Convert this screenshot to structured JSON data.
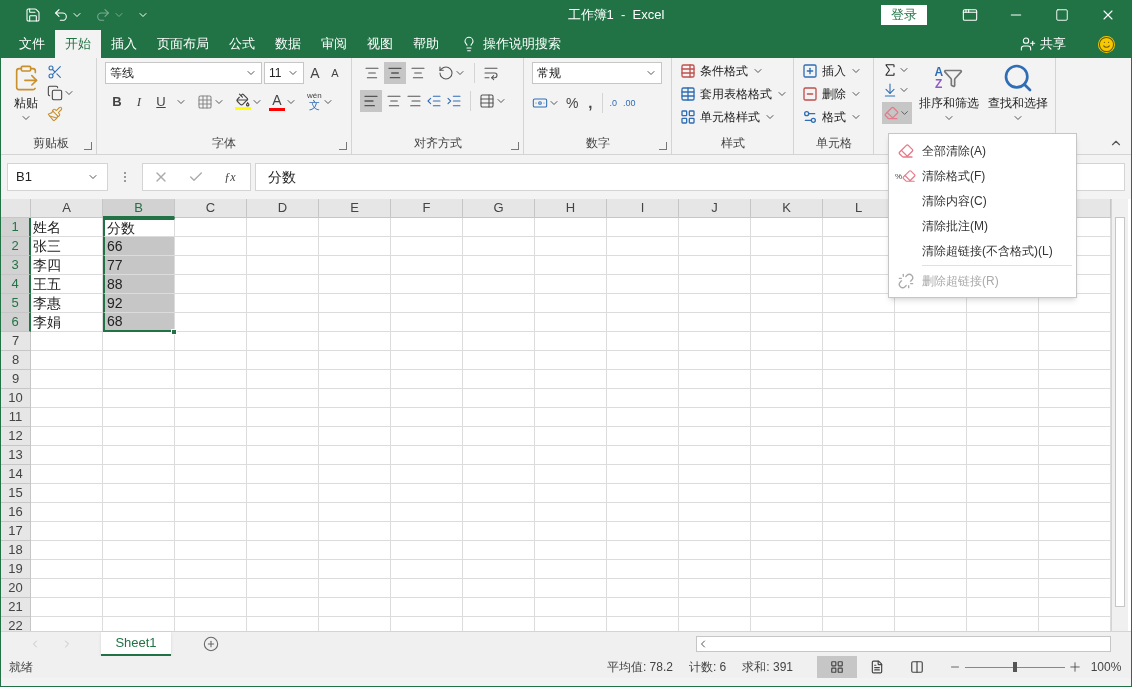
{
  "window": {
    "title": "工作簿1  -  Excel",
    "signin": "登录"
  },
  "tabs": [
    {
      "label": "文件",
      "selected": false
    },
    {
      "label": "开始",
      "selected": true
    },
    {
      "label": "插入",
      "selected": false
    },
    {
      "label": "页面布局",
      "selected": false
    },
    {
      "label": "公式",
      "selected": false
    },
    {
      "label": "数据",
      "selected": false
    },
    {
      "label": "审阅",
      "selected": false
    },
    {
      "label": "视图",
      "selected": false
    },
    {
      "label": "帮助",
      "selected": false
    }
  ],
  "tell_me": "操作说明搜索",
  "share": "共享",
  "ribbon": {
    "clipboard": {
      "paste": "粘贴",
      "label": "剪贴板"
    },
    "font": {
      "name": "等线",
      "size": "11",
      "grow": "A",
      "shrink": "A",
      "bold": "B",
      "italic": "I",
      "underline": "U",
      "font_color": "A",
      "phonetic_top": "wén",
      "phonetic_bottom": "文",
      "label": "字体"
    },
    "alignment": {
      "label": "对齐方式"
    },
    "number": {
      "format": "常规",
      "percent": "%",
      "comma": ",",
      "decimal_more": ".0",
      "decimal_less": ".00",
      "label": "数字"
    },
    "styles": {
      "items": [
        "条件格式",
        "套用表格格式",
        "单元格样式"
      ],
      "label": "样式"
    },
    "cells": {
      "items": [
        "插入",
        "删除",
        "格式"
      ],
      "label": "单元格"
    },
    "editing": {
      "sort_icon_top": "A",
      "sort_icon_bottom": "Z",
      "sort": "排序和筛选",
      "find": "查找和选择"
    }
  },
  "formula_bar": {
    "name_box": "B1",
    "function": "ƒx",
    "formula": "分数"
  },
  "columns": [
    {
      "label": "A",
      "selected": false
    },
    {
      "label": "B",
      "selected": true
    },
    {
      "label": "C",
      "selected": false
    },
    {
      "label": "D",
      "selected": false
    },
    {
      "label": "E",
      "selected": false
    },
    {
      "label": "F",
      "selected": false
    },
    {
      "label": "G",
      "selected": false
    },
    {
      "label": "H",
      "selected": false
    },
    {
      "label": "I",
      "selected": false
    },
    {
      "label": "J",
      "selected": false
    },
    {
      "label": "K",
      "selected": false
    },
    {
      "label": "L",
      "selected": false
    }
  ],
  "rows": [
    {
      "header": "1",
      "selected": true,
      "cells": [
        "姓名",
        "分数"
      ]
    },
    {
      "header": "2",
      "selected": true,
      "cells": [
        "张三",
        "66"
      ]
    },
    {
      "header": "3",
      "selected": true,
      "cells": [
        "李四",
        "77"
      ]
    },
    {
      "header": "4",
      "selected": true,
      "cells": [
        "王五",
        "88"
      ]
    },
    {
      "header": "5",
      "selected": true,
      "cells": [
        "李惠",
        "92"
      ]
    },
    {
      "header": "6",
      "selected": true,
      "cells": [
        "李娟",
        "68"
      ]
    },
    {
      "header": "7",
      "selected": false,
      "cells": []
    },
    {
      "header": "8",
      "selected": false,
      "cells": []
    },
    {
      "header": "9",
      "selected": false,
      "cells": []
    },
    {
      "header": "10",
      "selected": false,
      "cells": []
    },
    {
      "header": "11",
      "selected": false,
      "cells": []
    },
    {
      "header": "12",
      "selected": false,
      "cells": []
    },
    {
      "header": "13",
      "selected": false,
      "cells": []
    },
    {
      "header": "14",
      "selected": false,
      "cells": []
    },
    {
      "header": "15",
      "selected": false,
      "cells": []
    },
    {
      "header": "16",
      "selected": false,
      "cells": []
    },
    {
      "header": "17",
      "selected": false,
      "cells": []
    },
    {
      "header": "18",
      "selected": false,
      "cells": []
    },
    {
      "header": "19",
      "selected": false,
      "cells": []
    },
    {
      "header": "20",
      "selected": false,
      "cells": []
    },
    {
      "header": "21",
      "selected": false,
      "cells": []
    },
    {
      "header": "22",
      "selected": false,
      "cells": []
    }
  ],
  "clear_menu": [
    {
      "kind": "clear-all",
      "label": "全部清除(A)",
      "disabled": false
    },
    {
      "kind": "clear-formats",
      "icon_text": "%",
      "label": "清除格式(F)",
      "disabled": false
    },
    {
      "kind": "plain",
      "label": "清除内容(C)",
      "disabled": false
    },
    {
      "kind": "plain",
      "label": "清除批注(M)",
      "disabled": false
    },
    {
      "kind": "plain",
      "label": "清除超链接(不含格式)(L)",
      "disabled": false
    },
    {
      "kind": "remove-links",
      "label": "删除超链接(R)",
      "disabled": true
    }
  ],
  "sheets": [
    {
      "label": "Sheet1",
      "selected": true
    }
  ],
  "status_bar": {
    "status": "就绪",
    "stats": [
      "平均值: 78.2",
      "计数: 6",
      "求和: 391"
    ],
    "views": [
      {
        "kind": "normal",
        "selected": true
      },
      {
        "kind": "page-layout",
        "selected": false
      },
      {
        "kind": "page-break",
        "selected": false
      }
    ],
    "zoom": {
      "level": 0.5,
      "label": "100%"
    }
  }
}
